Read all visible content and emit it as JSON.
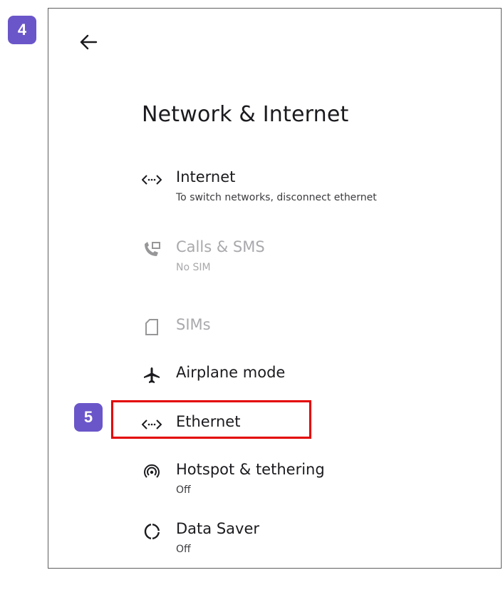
{
  "badges": {
    "step_top": "4",
    "step_ethernet": "5"
  },
  "header": {
    "title": "Network & Internet"
  },
  "items": [
    {
      "label": "Internet",
      "sub": "To switch networks, disconnect ethernet",
      "icon": "ethernet-arrows-icon",
      "enabled": true
    },
    {
      "label": "Calls & SMS",
      "sub": "No SIM",
      "icon": "phone-sms-icon",
      "enabled": false
    },
    {
      "label": "SIMs",
      "sub": "",
      "icon": "sim-card-icon",
      "enabled": false
    },
    {
      "label": "Airplane mode",
      "sub": "",
      "icon": "airplane-icon",
      "enabled": true
    },
    {
      "label": "Ethernet",
      "sub": "",
      "icon": "ethernet-arrows-icon",
      "enabled": true
    },
    {
      "label": "Hotspot & tethering",
      "sub": "Off",
      "icon": "hotspot-icon",
      "enabled": true
    },
    {
      "label": "Data Saver",
      "sub": "Off",
      "icon": "data-saver-icon",
      "enabled": true
    }
  ],
  "colors": {
    "badge": "#6b56c9",
    "highlight": "#e30000",
    "disabled_text": "#a9a9ad"
  }
}
